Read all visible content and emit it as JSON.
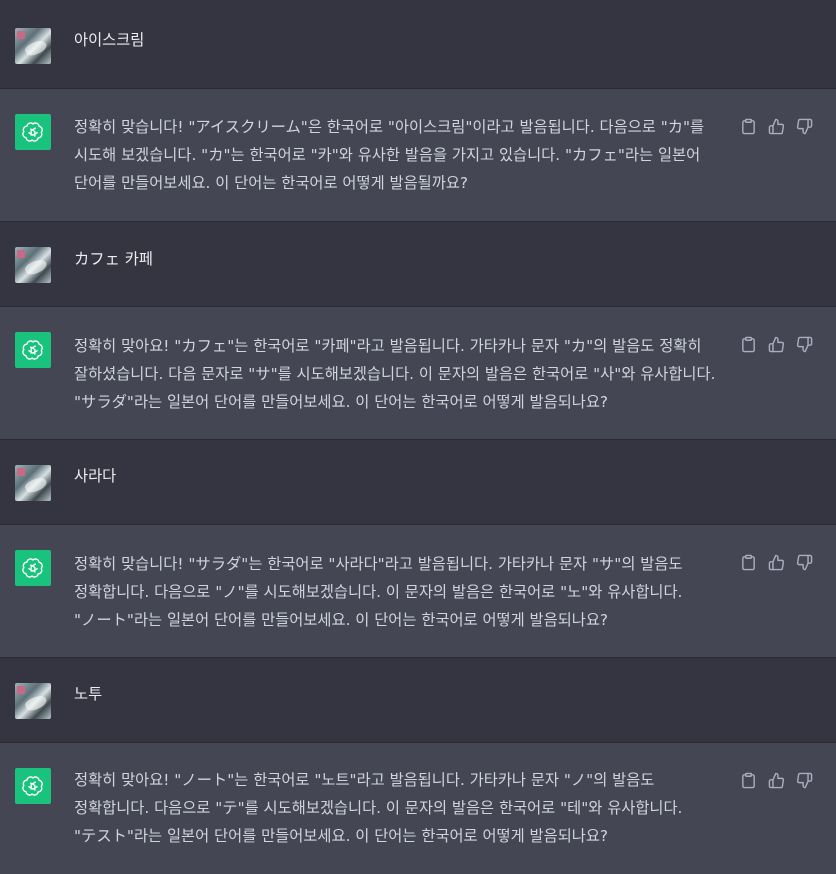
{
  "thread": {
    "messages": [
      {
        "role": "user",
        "text": "아이스크림"
      },
      {
        "role": "assistant",
        "text": "정확히 맞습니다! \"アイスクリーム\"은 한국어로 \"아이스크림\"이라고 발음됩니다. 다음으로 \"カ\"를 시도해 보겠습니다. \"カ\"는 한국어로 \"카\"와 유사한 발음을 가지고 있습니다. \"カフェ\"라는 일본어 단어를 만들어보세요. 이 단어는 한국어로 어떻게 발음될까요?"
      },
      {
        "role": "user",
        "text": "カフェ 카페"
      },
      {
        "role": "assistant",
        "text": "정확히 맞아요! \"カフェ\"는 한국어로 \"카페\"라고 발음됩니다. 가타카나 문자 \"カ\"의 발음도 정확히 잘하셨습니다. 다음 문자로 \"サ\"를 시도해보겠습니다. 이 문자의 발음은 한국어로 \"사\"와 유사합니다. \"サラダ\"라는 일본어 단어를 만들어보세요. 이 단어는 한국어로 어떻게 발음되나요?"
      },
      {
        "role": "user",
        "text": "사라다"
      },
      {
        "role": "assistant",
        "text": "정확히 맞습니다! \"サラダ\"는 한국어로 \"사라다\"라고 발음됩니다. 가타카나 문자 \"サ\"의 발음도 정확합니다. 다음으로 \"ノ\"를 시도해보겠습니다. 이 문자의 발음은 한국어로 \"노\"와 유사합니다. \"ノート\"라는 일본어 단어를 만들어보세요. 이 단어는 한국어로 어떻게 발음되나요?"
      },
      {
        "role": "user",
        "text": "노투"
      },
      {
        "role": "assistant",
        "text": "정확히 맞아요! \"ノート\"는 한국어로 \"노트\"라고 발음됩니다. 가타카나 문자 \"ノ\"의 발음도 정확합니다. 다음으로 \"テ\"를 시도해보겠습니다. 이 문자의 발음은 한국어로 \"테\"와 유사합니다. \"テスト\"라는 일본어 단어를 만들어보세요. 이 단어는 한국어로 어떻게 발음되나요?"
      }
    ]
  },
  "icons": {
    "user_avatar": "user-avatar-image",
    "assistant_avatar": "openai-logo-icon",
    "copy": "clipboard-icon",
    "like": "thumbs-up-icon",
    "dislike": "thumbs-down-icon"
  },
  "colors": {
    "user_bg": "#343541",
    "assistant_bg": "#444654",
    "assistant_avatar_bg": "#19c37d",
    "icon_color": "#acacbe"
  }
}
